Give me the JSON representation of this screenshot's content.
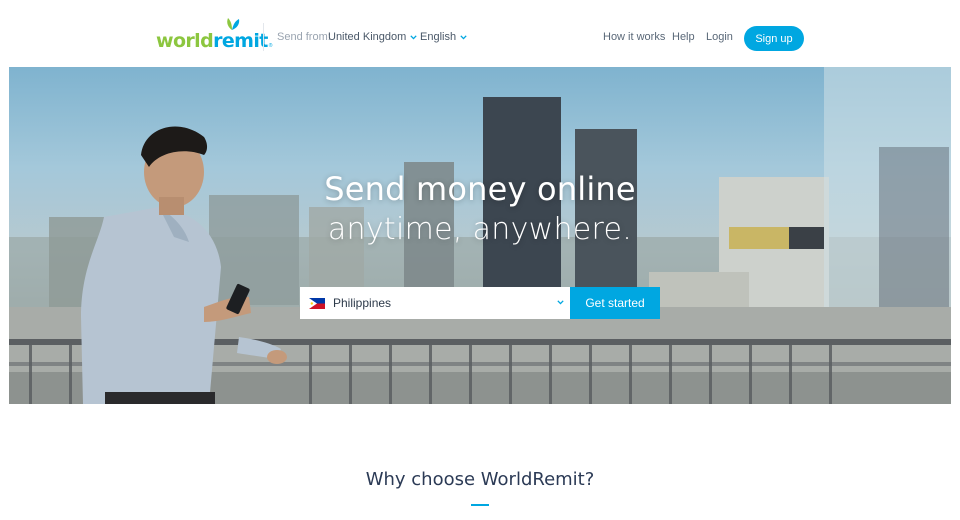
{
  "brand": {
    "logo_part1": "world",
    "logo_part2": "remit",
    "logo_mark": "®",
    "colors": {
      "green": "#8cc63f",
      "blue": "#00a7e1"
    }
  },
  "header": {
    "send_from_label": "Send from:",
    "send_from_value": "United Kingdom",
    "language": "English",
    "nav": {
      "how_it_works": "How it works",
      "help": "Help",
      "login": "Login",
      "signup": "Sign up"
    }
  },
  "hero": {
    "title_line1": "Send money online",
    "title_line2": "anytime, anywhere.",
    "destination": {
      "value": "Philippines",
      "flag_icon": "philippines-flag-icon"
    },
    "cta": "Get started"
  },
  "section": {
    "title": "Why choose WorldRemit?"
  }
}
